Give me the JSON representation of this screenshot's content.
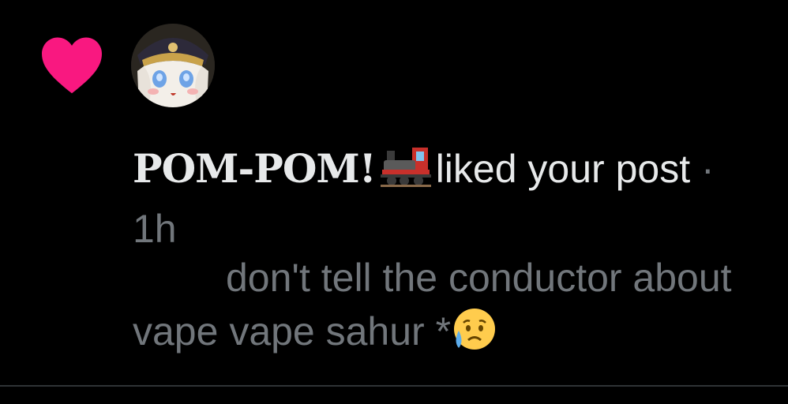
{
  "notification": {
    "username": "POM-POM!",
    "action_text": "liked your post",
    "separator": "·",
    "timestamp": "1h",
    "post_text": "don't tell the conductor about  vape vape sahur *",
    "icons": {
      "like": "heart-icon",
      "user_emoji": "steam-locomotive-emoji",
      "post_emoji": "sad-but-relieved-face-emoji"
    },
    "colors": {
      "heart": "#f91880",
      "text_primary": "#e7e9ea",
      "text_secondary": "#71767b",
      "background": "#000000"
    }
  }
}
